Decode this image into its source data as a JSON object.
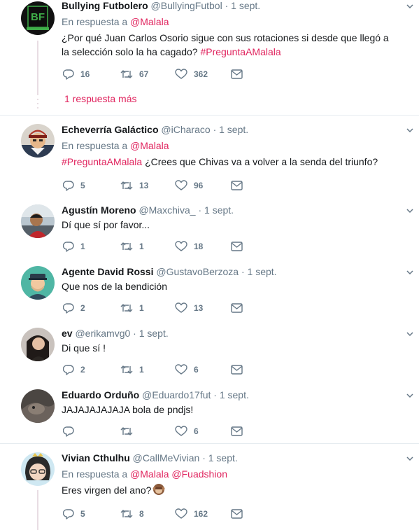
{
  "tweets": [
    {
      "name": "Bullying Futbolero",
      "handle": "@BullyingFutbol",
      "time": "1 sept.",
      "reply_prefix": "En respuesta a",
      "reply_mentions": [
        "@Malala"
      ],
      "text": "¿Por qué Juan Carlos Osorio sigue con sus rotaciones si desde que llegó a la selección solo la ha cagado?",
      "hashtag": "#PreguntaAMalala",
      "replies": "16",
      "retweets": "67",
      "likes": "362",
      "more_replies": "1 respuesta más"
    },
    {
      "name": "Echeverría Galáctico",
      "handle": "@iCharaco",
      "time": "1 sept.",
      "reply_prefix": "En respuesta a",
      "reply_mentions": [
        "@Malala"
      ],
      "hashtag": "#PreguntaAMalala",
      "text": "¿Crees que Chivas va a volver a la senda del triunfo?",
      "replies": "5",
      "retweets": "13",
      "likes": "96"
    },
    {
      "name": "Agustín Moreno",
      "handle": "@Maxchiva_",
      "time": "1 sept.",
      "text": "Dí que sí por favor...",
      "replies": "1",
      "retweets": "1",
      "likes": "18"
    },
    {
      "name": "Agente David Rossi",
      "handle": "@GustavoBerzoza",
      "time": "1 sept.",
      "text": "Que nos de la bendición",
      "replies": "2",
      "retweets": "1",
      "likes": "13"
    },
    {
      "name": "ev",
      "handle": "@erikamvg0",
      "time": "1 sept.",
      "text": "Di que sí !",
      "replies": "2",
      "retweets": "1",
      "likes": "6"
    },
    {
      "name": "Eduardo Orduño",
      "handle": "@Eduardo17fut",
      "time": "1 sept.",
      "text": "JAJAJAJAJAJA bola de pndjs!",
      "replies": "",
      "retweets": "",
      "likes": "6"
    },
    {
      "name": "Vivian Cthulhu",
      "handle": "@CallMeVivian",
      "time": "1 sept.",
      "reply_prefix": "En respuesta a",
      "reply_mentions": [
        "@Malala",
        "@Fuadshion"
      ],
      "text": "Eres virgen del ano?",
      "replies": "5",
      "retweets": "8",
      "likes": "162"
    }
  ],
  "colors": {
    "accent": "#e0245e",
    "muted": "#657786",
    "thread": "#e8dde3"
  },
  "icons": [
    "reply-icon",
    "retweet-icon",
    "like-icon",
    "message-icon",
    "chevron-down-icon"
  ]
}
